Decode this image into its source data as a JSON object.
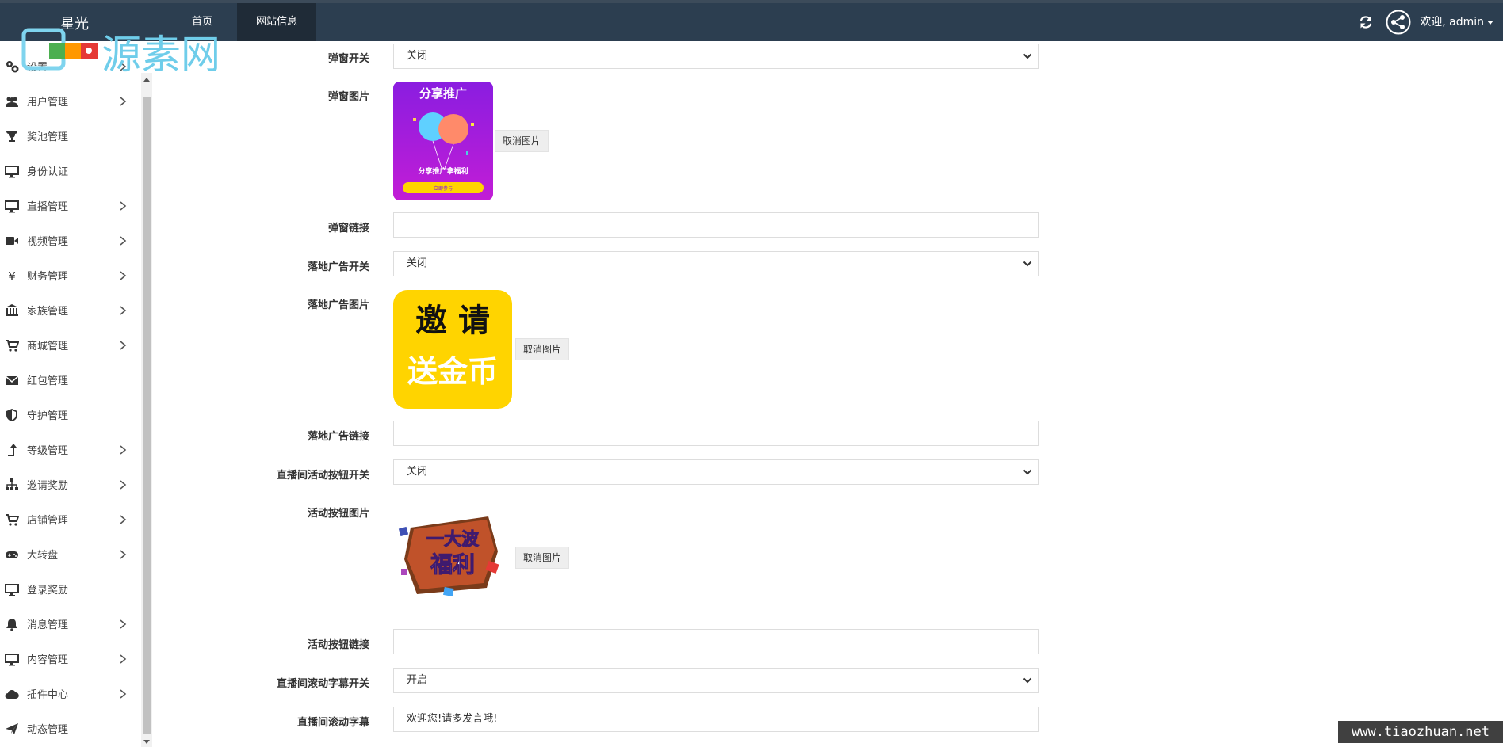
{
  "app": {
    "brand": "星光",
    "watermark_logo": "源素网"
  },
  "nav": {
    "tabs": [
      {
        "label": "首页",
        "active": false
      },
      {
        "label": "网站信息",
        "active": true
      }
    ],
    "welcome": "欢迎, admin"
  },
  "sidebar": {
    "items": [
      {
        "label": "设置",
        "icon": "gears-icon",
        "chevron": true
      },
      {
        "label": "用户管理",
        "icon": "users-icon",
        "chevron": true
      },
      {
        "label": "奖池管理",
        "icon": "trophy-icon",
        "chevron": false
      },
      {
        "label": "身份认证",
        "icon": "monitor-icon",
        "chevron": false
      },
      {
        "label": "直播管理",
        "icon": "monitor-icon",
        "chevron": true
      },
      {
        "label": "视频管理",
        "icon": "video-camera-icon",
        "chevron": true
      },
      {
        "label": "财务管理",
        "icon": "yen-icon",
        "chevron": true
      },
      {
        "label": "家族管理",
        "icon": "bank-icon",
        "chevron": true
      },
      {
        "label": "商城管理",
        "icon": "cart-icon",
        "chevron": true
      },
      {
        "label": "红包管理",
        "icon": "envelope-icon",
        "chevron": false
      },
      {
        "label": "守护管理",
        "icon": "shield-icon",
        "chevron": false
      },
      {
        "label": "等级管理",
        "icon": "level-up-icon",
        "chevron": true
      },
      {
        "label": "邀请奖励",
        "icon": "sitemap-icon",
        "chevron": true
      },
      {
        "label": "店铺管理",
        "icon": "cart-icon",
        "chevron": true
      },
      {
        "label": "大转盘",
        "icon": "gamepad-icon",
        "chevron": true
      },
      {
        "label": "登录奖励",
        "icon": "monitor-icon",
        "chevron": false
      },
      {
        "label": "消息管理",
        "icon": "bell-icon",
        "chevron": true
      },
      {
        "label": "内容管理",
        "icon": "monitor-icon",
        "chevron": true
      },
      {
        "label": "插件中心",
        "icon": "cloud-icon",
        "chevron": true
      },
      {
        "label": "动态管理",
        "icon": "paper-plane-icon",
        "chevron": false
      }
    ]
  },
  "form": {
    "popup_switch": {
      "label": "弹窗开关",
      "value": "关闭"
    },
    "popup_image": {
      "label": "弹窗图片",
      "cancel": "取消图片",
      "img_title": "分享推广",
      "img_sub": "分享推广拿福利",
      "img_btn": "立即参与"
    },
    "popup_link": {
      "label": "弹窗链接",
      "value": ""
    },
    "landing_switch": {
      "label": "落地广告开关",
      "value": "关闭"
    },
    "landing_image": {
      "label": "落地广告图片",
      "cancel": "取消图片",
      "img_line1": "邀 请",
      "img_line2": "送金币"
    },
    "landing_link": {
      "label": "落地广告链接",
      "value": ""
    },
    "activity_switch": {
      "label": "直播间活动按钮开关",
      "value": "关闭"
    },
    "activity_image": {
      "label": "活动按钮图片",
      "cancel": "取消图片",
      "img_line1": "一大波",
      "img_line2": "福利"
    },
    "activity_link": {
      "label": "活动按钮链接",
      "value": ""
    },
    "marquee_switch": {
      "label": "直播间滚动字幕开关",
      "value": "开启"
    },
    "marquee_text": {
      "label": "直播间滚动字幕",
      "value": "欢迎您!请多发言哦!"
    }
  },
  "footer_watermark": "www.tiaozhuan.net",
  "colors": {
    "topbar": "#2c3e50",
    "active_tab": "#1f2b37",
    "popup_purple": "#9b1ee0",
    "landing_yellow": "#ffd400"
  }
}
